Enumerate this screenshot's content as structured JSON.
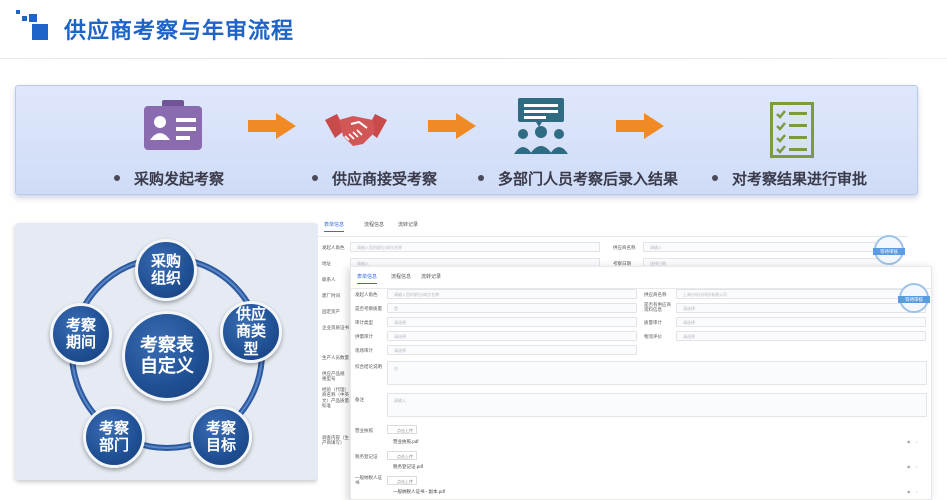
{
  "header": {
    "title": "供应商考察与年审流程"
  },
  "process": {
    "steps": [
      {
        "label": "采购发起考察",
        "icon": "id-card-icon"
      },
      {
        "label": "供应商接受考察",
        "icon": "handshake-icon"
      },
      {
        "label": "多部门人员考察后录入结果",
        "icon": "team-meeting-icon"
      },
      {
        "label": "对考察结果进行审批",
        "icon": "checklist-icon"
      }
    ],
    "arrow_color": "#f08a24",
    "icon_colors": {
      "id_card": "#8a6bb0",
      "handshake": "#c94a4a",
      "team": "#2f6b82",
      "checklist": "#7d9a3d"
    }
  },
  "cycle": {
    "center": "考察表自定义",
    "nodes": [
      "采购组织",
      "供应商类型",
      "考察目标",
      "考察部门",
      "考察期间"
    ]
  },
  "formA": {
    "tabs": [
      "表单信息",
      "流程信息",
      "流转记录"
    ],
    "fields": [
      {
        "label": "发起人角色",
        "placeholder": "请输入您的职位/岗位名称"
      },
      {
        "label": "地址",
        "placeholder": "请输入"
      },
      {
        "label": "联系人",
        "placeholder": ""
      },
      {
        "label": "建厂时间",
        "placeholder": ""
      },
      {
        "label": "固定资产",
        "placeholder": ""
      },
      {
        "label": "企业资质证书",
        "placeholder": ""
      },
      {
        "label": "生产人员数量",
        "placeholder": ""
      },
      {
        "label": "供应产品规格型号",
        "placeholder": ""
      },
      {
        "label": "经验（代理）商名称（中英文）产品质量标准",
        "placeholder": ""
      },
      {
        "label": "调查内容（生产商填写）",
        "placeholder": ""
      }
    ],
    "right_fields": [
      {
        "label": "供应商名称",
        "placeholder": "请输入"
      },
      {
        "label": "考察日期",
        "placeholder": "选择日期"
      }
    ],
    "stamp": "等待审核"
  },
  "formB": {
    "tabs": [
      "表单信息",
      "流程信息",
      "流转记录"
    ],
    "fields_left": [
      {
        "label": "发起人角色",
        "placeholder": "请输入您的职位/岗位名称"
      },
      {
        "label": "是否考察质量",
        "placeholder": "是"
      },
      {
        "label": "审计类型",
        "placeholder": "请选择"
      },
      {
        "label": "供需审计",
        "placeholder": "请选择"
      },
      {
        "label": "现场审计",
        "placeholder": "请选择"
      }
    ],
    "fields_right": [
      {
        "label": "供应商名称",
        "placeholder": "上海分析仪科技有限公司"
      },
      {
        "label": "是否有供应商资料信息",
        "placeholder": "请选择"
      },
      {
        "label": "质量审计",
        "placeholder": "请选择"
      },
      {
        "label": "物流评价",
        "placeholder": "请选择"
      }
    ],
    "summary_label": "综合结论说明",
    "summary_placeholder": "在",
    "remark_label": "备注",
    "remark_placeholder": "请输入",
    "upload_label": "点击上传",
    "files": [
      {
        "label": "营业执照",
        "file": "营业执照.pdf"
      },
      {
        "label": "税务登记证",
        "file": "税务登记证.pdf"
      },
      {
        "label": "一般纳税人证书",
        "file": "一般纳税人证书 - 副本.pdf"
      }
    ],
    "stamp": "等待审核"
  }
}
